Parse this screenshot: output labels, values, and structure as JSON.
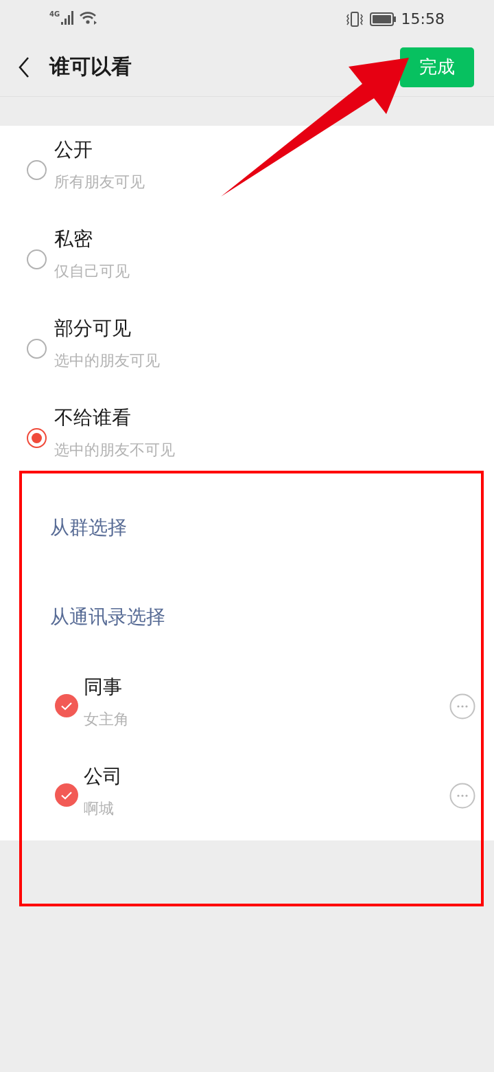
{
  "status_bar": {
    "network": "4G",
    "time": "15:58"
  },
  "nav": {
    "title": "谁可以看",
    "done_button": "完成"
  },
  "visibility_options": [
    {
      "title": "公开",
      "subtitle": "所有朋友可见",
      "selected": false
    },
    {
      "title": "私密",
      "subtitle": "仅自己可见",
      "selected": false
    },
    {
      "title": "部分可见",
      "subtitle": "选中的朋友可见",
      "selected": false
    },
    {
      "title": "不给谁看",
      "subtitle": "选中的朋友不可见",
      "selected": true
    }
  ],
  "select_links": [
    "从群选择",
    "从通讯录选择"
  ],
  "selected_tags": [
    {
      "name": "同事",
      "members": "女主角",
      "checked": true
    },
    {
      "name": "公司",
      "members": "啊城",
      "checked": true
    }
  ],
  "annotations": {
    "arrow": true,
    "highlight_frame": true
  }
}
